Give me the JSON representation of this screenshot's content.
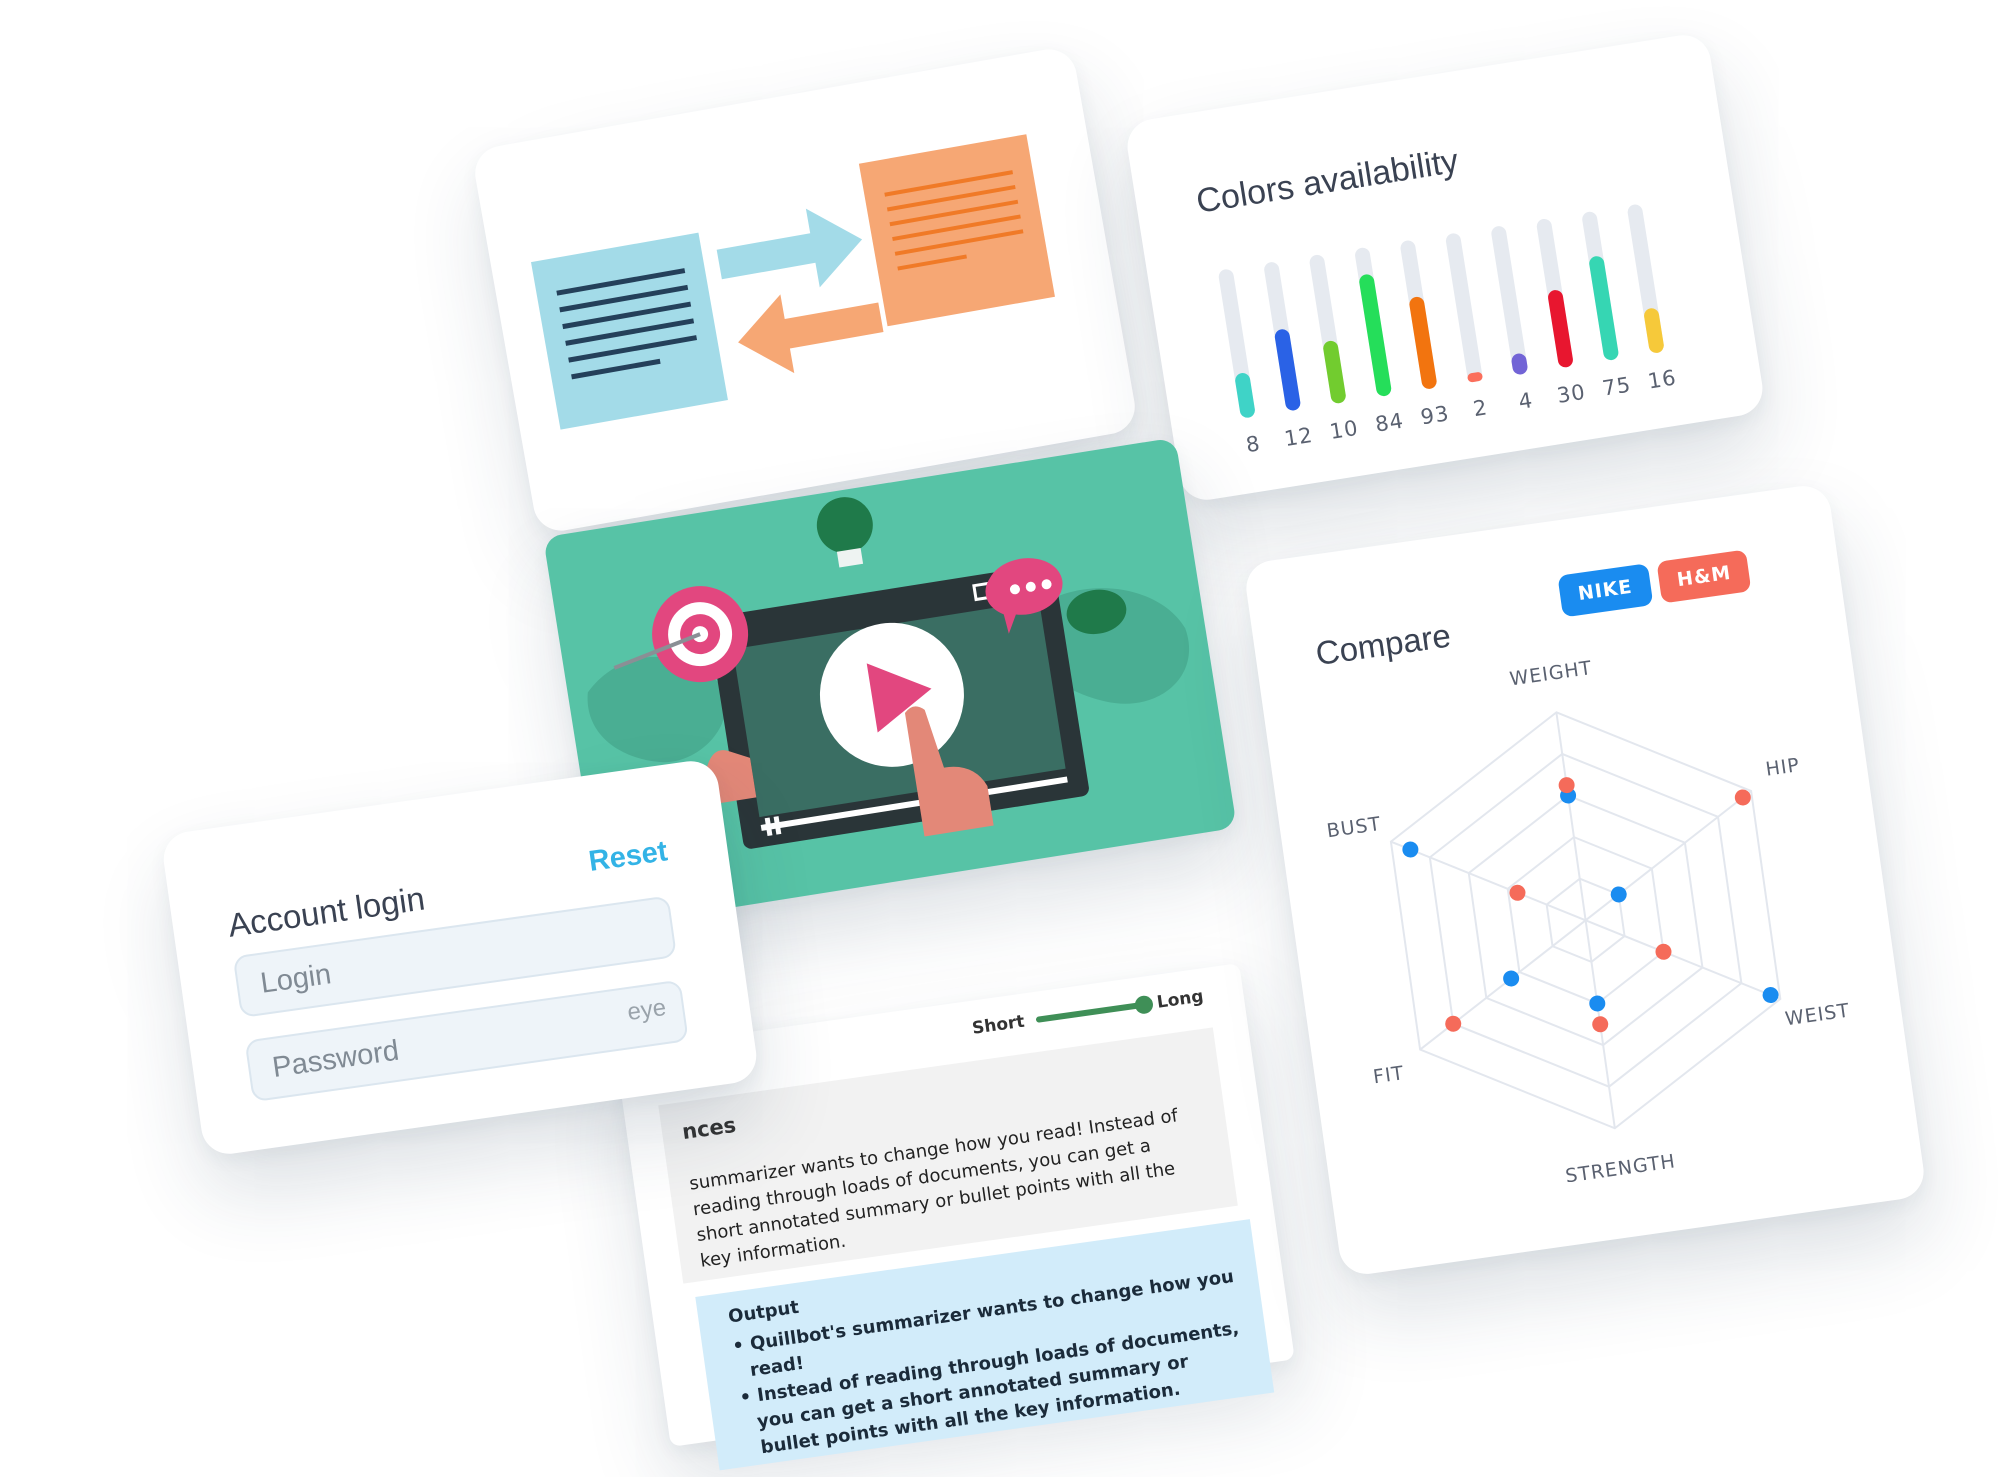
{
  "colors": {
    "title": "Colors availability",
    "bars": [
      {
        "value": "8",
        "fill": 0.3,
        "color": "#3fd3c7"
      },
      {
        "value": "12",
        "fill": 0.55,
        "color": "#2a62e6"
      },
      {
        "value": "10",
        "fill": 0.42,
        "color": "#72cc2f"
      },
      {
        "value": "84",
        "fill": 0.82,
        "color": "#25de5a"
      },
      {
        "value": "93",
        "fill": 0.62,
        "color": "#f2740f"
      },
      {
        "value": "2",
        "fill": 0.06,
        "color": "#fb6f5c"
      },
      {
        "value": "4",
        "fill": 0.14,
        "color": "#7264d6"
      },
      {
        "value": "30",
        "fill": 0.52,
        "color": "#e8162f"
      },
      {
        "value": "75",
        "fill": 0.7,
        "color": "#36d6b3"
      },
      {
        "value": "16",
        "fill": 0.3,
        "color": "#f6c93a"
      }
    ]
  },
  "summarizer": {
    "length_short": "Short",
    "length_long": "Long",
    "length_level": 1.0,
    "sentences_label": "nces",
    "input_text": "summarizer wants to change how you read! Instead of reading through loads of documents, you can get a short annotated summary or bullet points with all the key information.",
    "output_label": "Output",
    "output_bullets": [
      "• Quillbot's summarizer wants to change how you read!",
      "• Instead of reading through loads of documents, you can get a short annotated summary or bullet points with all the key information."
    ]
  },
  "login": {
    "title": "Account login",
    "reset": "Reset",
    "login_placeholder": "Login",
    "password_placeholder": "Password",
    "eye_label": "eye"
  },
  "compare": {
    "title": "Compare",
    "tags": [
      {
        "label": "NIKE",
        "color": "#1a8cf0"
      },
      {
        "label": "H&M",
        "color": "#f56b5a"
      }
    ],
    "axes": [
      "WEIGHT",
      "HIP",
      "WEIST",
      "STRENGTH",
      "FIT",
      "BUST"
    ],
    "series": [
      {
        "color": "#1a8cf0",
        "values": [
          0.6,
          0.2,
          0.95,
          0.4,
          0.45,
          0.9
        ]
      },
      {
        "color": "#f56b5a",
        "values": [
          0.65,
          0.95,
          0.4,
          0.5,
          0.8,
          0.35
        ]
      }
    ]
  }
}
